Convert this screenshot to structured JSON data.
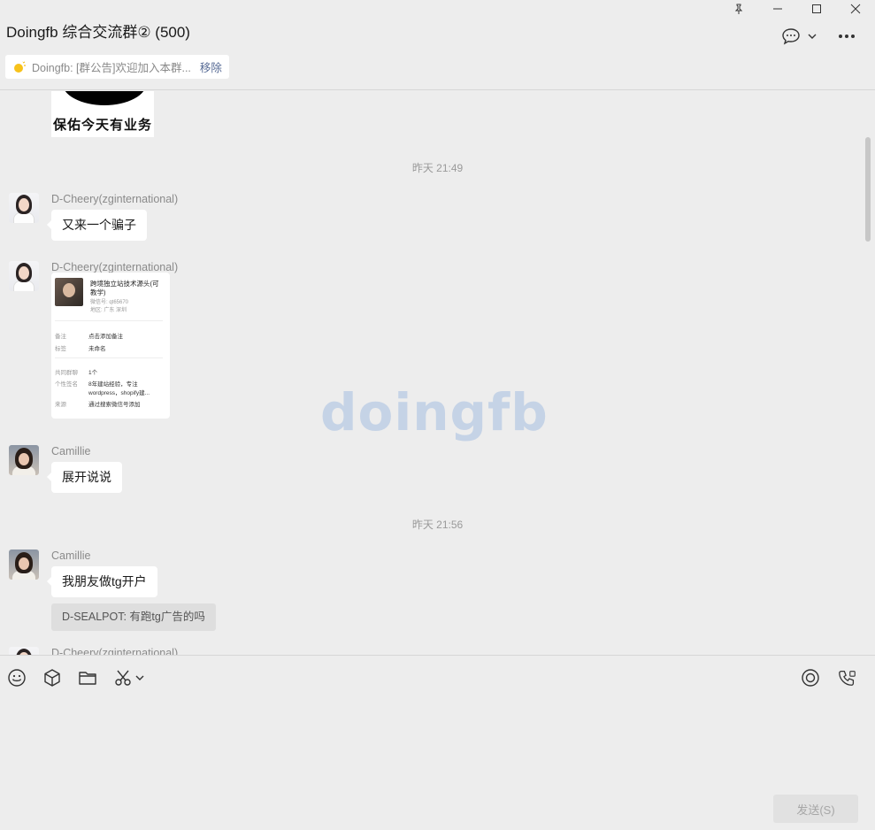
{
  "window": {
    "pin_icon": "pin-icon",
    "minimize_icon": "minimize-icon",
    "maximize_icon": "maximize-icon",
    "close_icon": "close-icon"
  },
  "header": {
    "title": "Doingfb 综合交流群② (500)",
    "notice": {
      "text": "Doingfb: [群公告]欢迎加入本群...",
      "remove_label": "移除"
    }
  },
  "chat": {
    "sticker_text": "保佑今天有业务",
    "timestamps": [
      "昨天 21:49",
      "昨天 21:56"
    ],
    "messages": [
      {
        "sender": "D-Cheery(zginternational)",
        "text": "又来一个骗子"
      },
      {
        "sender": "D-Cheery(zginternational)",
        "type": "image"
      },
      {
        "sender": "Camillie",
        "text": "展开说说"
      },
      {
        "sender": "Camillie",
        "text": "我朋友做tg开户",
        "quote": "D-SEALPOT: 有跑tg广告的吗"
      },
      {
        "sender": "D-Cheery(zginternational)"
      }
    ],
    "card": {
      "name": "跨境独立站技术源头(可教学)",
      "sub1": "微信号: qt65670",
      "sub2": "地区: 广东 深圳",
      "rows": [
        {
          "k": "备注",
          "v": "点击添加备注"
        },
        {
          "k": "标签",
          "v": "未命名"
        },
        {
          "k": "共同群聊",
          "v": "1个"
        },
        {
          "k": "个性签名",
          "v": "8年建站经验，专注"
        },
        {
          "k": "",
          "v": "wordpress，shopify建..."
        },
        {
          "k": "来源",
          "v": "通过搜索微信号添加"
        }
      ]
    },
    "watermark": "doingfb"
  },
  "composer": {
    "send_label": "发送(S)"
  },
  "colors": {
    "background": "#ededed",
    "bubble": "#ffffff",
    "link": "#576b95",
    "watermark": "#c5d3e6"
  }
}
